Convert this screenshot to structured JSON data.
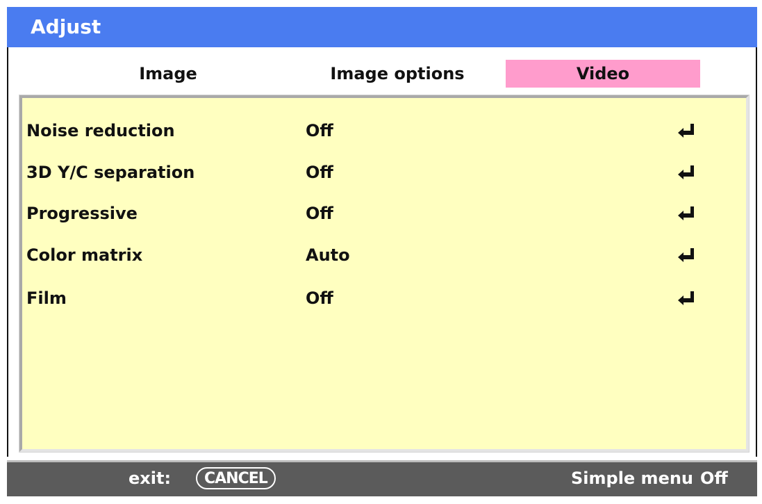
{
  "window": {
    "title": "Adjust"
  },
  "tabs": [
    {
      "label": "Image",
      "active": false
    },
    {
      "label": "Image options",
      "active": false
    },
    {
      "label": "Video",
      "active": true
    }
  ],
  "settings": [
    {
      "label": "Noise reduction",
      "value": "Off",
      "icon": "enter-return-icon"
    },
    {
      "label": "3D Y/C separation",
      "value": "Off",
      "icon": "enter-return-icon"
    },
    {
      "label": "Progressive",
      "value": "Off",
      "icon": "enter-return-icon"
    },
    {
      "label": "Color matrix",
      "value": "Auto",
      "icon": "enter-return-icon"
    },
    {
      "label": "Film",
      "value": "Off",
      "icon": "enter-return-icon"
    }
  ],
  "status": {
    "exit_label": "exit:",
    "cancel_key": "CANCEL",
    "simple_menu_label": "Simple menu",
    "simple_menu_value": "Off"
  },
  "colors": {
    "title_bar": "#4a7cf0",
    "active_tab": "#ff9ccc",
    "panel": "#ffffc0",
    "status_bar": "#5b5b5b"
  }
}
